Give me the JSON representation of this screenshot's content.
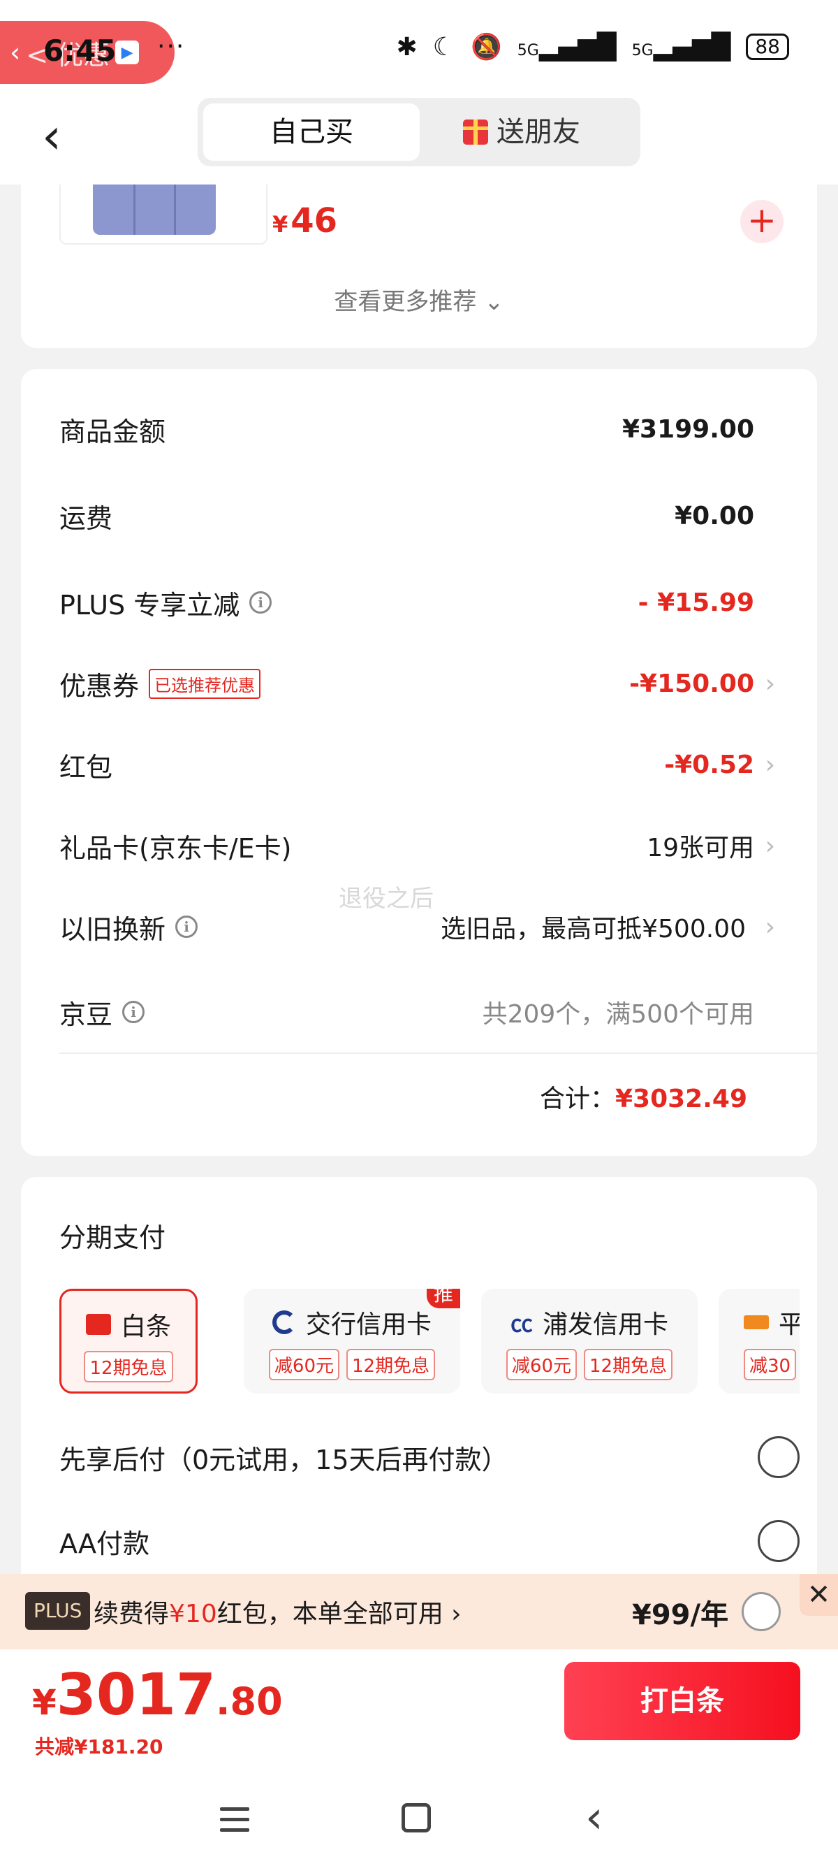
{
  "status_bar": {
    "time": "6:45",
    "back_app_label": "< 优惠",
    "network": "5G",
    "battery": "88"
  },
  "header": {
    "tab_self": "自己买",
    "tab_gift": "送朋友"
  },
  "recommend": {
    "item_price_symbol": "¥",
    "item_price": "46",
    "more_label": "查看更多推荐 ⌄"
  },
  "summary": {
    "rows": [
      {
        "label": "商品金额",
        "value": "¥3199.00"
      },
      {
        "label": "运费",
        "value": "¥0.00"
      },
      {
        "label": "PLUS 专享立减",
        "value": "- ¥15.99"
      },
      {
        "label": "优惠券",
        "tag": "已选推荐优惠",
        "value": "-¥150.00"
      },
      {
        "label": "红包",
        "value": "-¥0.52"
      },
      {
        "label": "礼品卡(京东卡/E卡)",
        "value": "19张可用"
      },
      {
        "label": "以旧换新",
        "value": "选旧品，最高可抵¥500.00"
      },
      {
        "label": "京豆",
        "value": "共209个，满500个可用"
      }
    ],
    "total_label": "合计：",
    "total_value": "¥3032.49",
    "watermark": "退役之后"
  },
  "installment": {
    "title": "分期支付",
    "options": [
      {
        "name": "白条",
        "tags": [
          "12期免息"
        ],
        "selected": true
      },
      {
        "name": "交行信用卡",
        "tags": [
          "减60元",
          "12期免息"
        ],
        "badge": "推"
      },
      {
        "name": "浦发信用卡",
        "tags": [
          "减60元",
          "12期免息"
        ]
      },
      {
        "name": "平",
        "tags": [
          "减30"
        ]
      }
    ],
    "pay_later": "先享后付（0元试用，15天后再付款）",
    "aa_pay": "AA付款"
  },
  "plus_banner": {
    "logo": "PLUS",
    "text_pre": "续费得",
    "text_hl": "¥10",
    "text_post": "红包，本单全部可用 ›",
    "price": "¥99/年",
    "close": "✕"
  },
  "bottom_bar": {
    "price_symbol": "¥",
    "price_int": "3017",
    "price_dec": ".80",
    "saved": "共减¥181.20",
    "pay_button": "打白条"
  },
  "colors": {
    "accent": "#e4271f",
    "background": "#f2f2f2"
  }
}
